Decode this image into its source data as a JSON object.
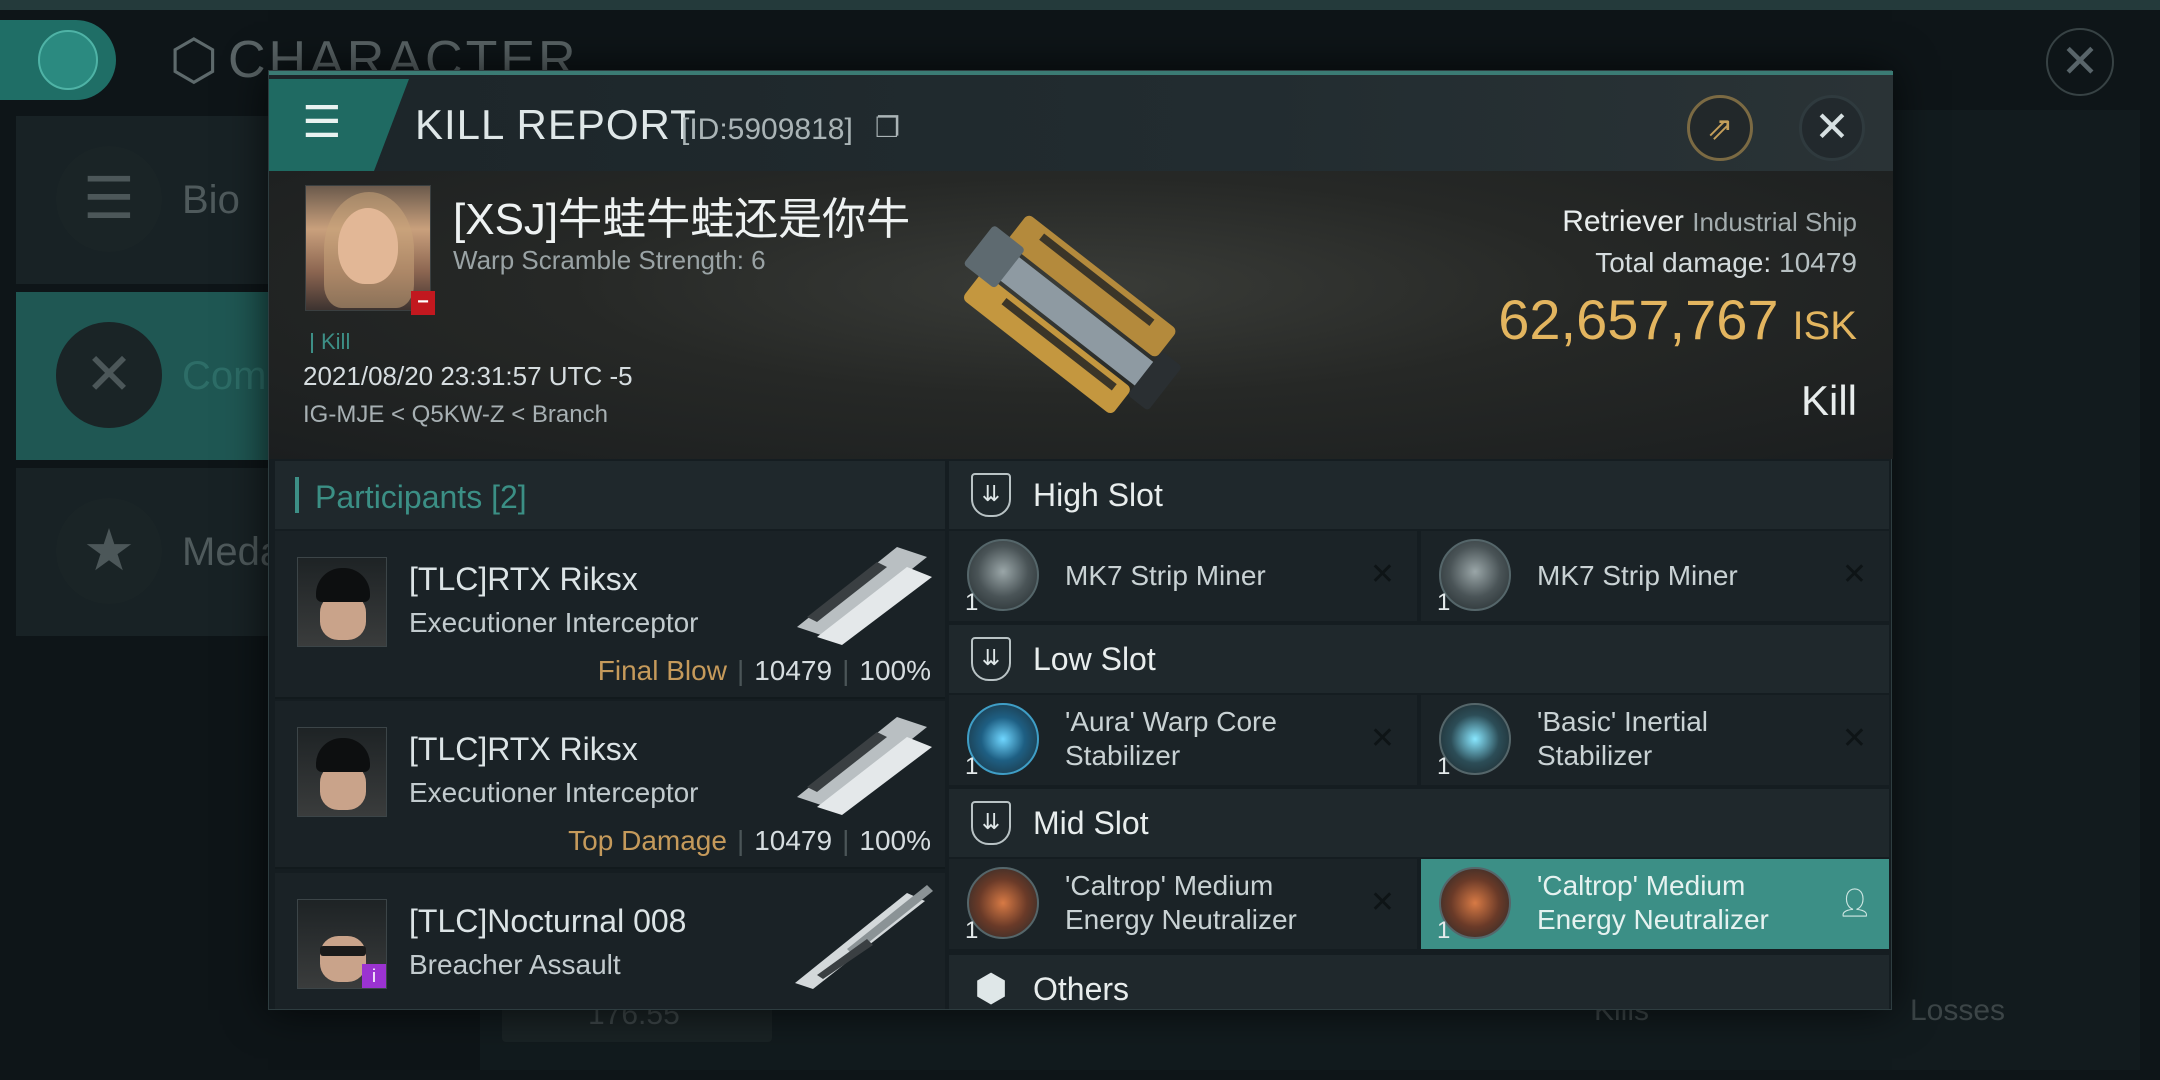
{
  "background": {
    "title": "CHARACTER",
    "sidebar": [
      {
        "label": "Bio",
        "icon": "menu-lines-icon"
      },
      {
        "label": "Com",
        "icon": "crossed-swords-icon"
      },
      {
        "label": "Meda",
        "icon": "star-badge-icon"
      }
    ],
    "stat_value": "176.55",
    "kills_label": "Kills",
    "losses_label": "Losses"
  },
  "modal": {
    "title": "KILL REPORT",
    "id_text": "[ID:5909818]",
    "victim": {
      "name": "[XSJ]牛蛙牛蛙还是你牛",
      "warp_scramble": "Warp Scramble Strength: 6",
      "kill_tag": "Kill",
      "time": "2021/08/20 23:31:57 UTC -5",
      "location": "IG-MJE < Q5KW-Z < Branch",
      "ship_name": "Retriever",
      "ship_class": "Industrial Ship",
      "total_damage_label": "Total damage:",
      "total_damage": "10479",
      "isk_value": "62,657,767",
      "isk_unit": "ISK",
      "result": "Kill"
    },
    "participants": {
      "header": "Participants [2]",
      "rows": [
        {
          "name": "[TLC]RTX Riksx",
          "ship": "Executioner Interceptor",
          "role": "Final Blow",
          "damage": "10479",
          "percent": "100%"
        },
        {
          "name": "[TLC]RTX Riksx",
          "ship": "Executioner Interceptor",
          "role": "Top Damage",
          "damage": "10479",
          "percent": "100%"
        },
        {
          "name": "[TLC]Nocturnal 008",
          "ship": "Breacher Assault",
          "badge": "i"
        }
      ]
    },
    "slots": {
      "high": {
        "label": "High Slot",
        "modules": [
          {
            "qty": "1",
            "line1": "MK7 Strip Miner",
            "line2": ""
          },
          {
            "qty": "1",
            "line1": "MK7 Strip Miner",
            "line2": ""
          }
        ]
      },
      "low": {
        "label": "Low Slot",
        "modules": [
          {
            "qty": "1",
            "line1": "'Aura' Warp Core",
            "line2": "Stabilizer"
          },
          {
            "qty": "1",
            "line1": "'Basic'  Inertial",
            "line2": "Stabilizer"
          }
        ]
      },
      "mid": {
        "label": "Mid Slot",
        "modules": [
          {
            "qty": "1",
            "line1": "'Caltrop' Medium",
            "line2": "Energy Neutralizer"
          },
          {
            "qty": "1",
            "line1": "'Caltrop' Medium",
            "line2": "Energy Neutralizer"
          }
        ]
      },
      "others": {
        "label": "Others"
      }
    }
  },
  "colors": {
    "accent_teal": "#3d8f86",
    "isk_gold": "#e3b55f",
    "role_gold": "#c59a5b",
    "selected_module": "#3c8f86"
  }
}
